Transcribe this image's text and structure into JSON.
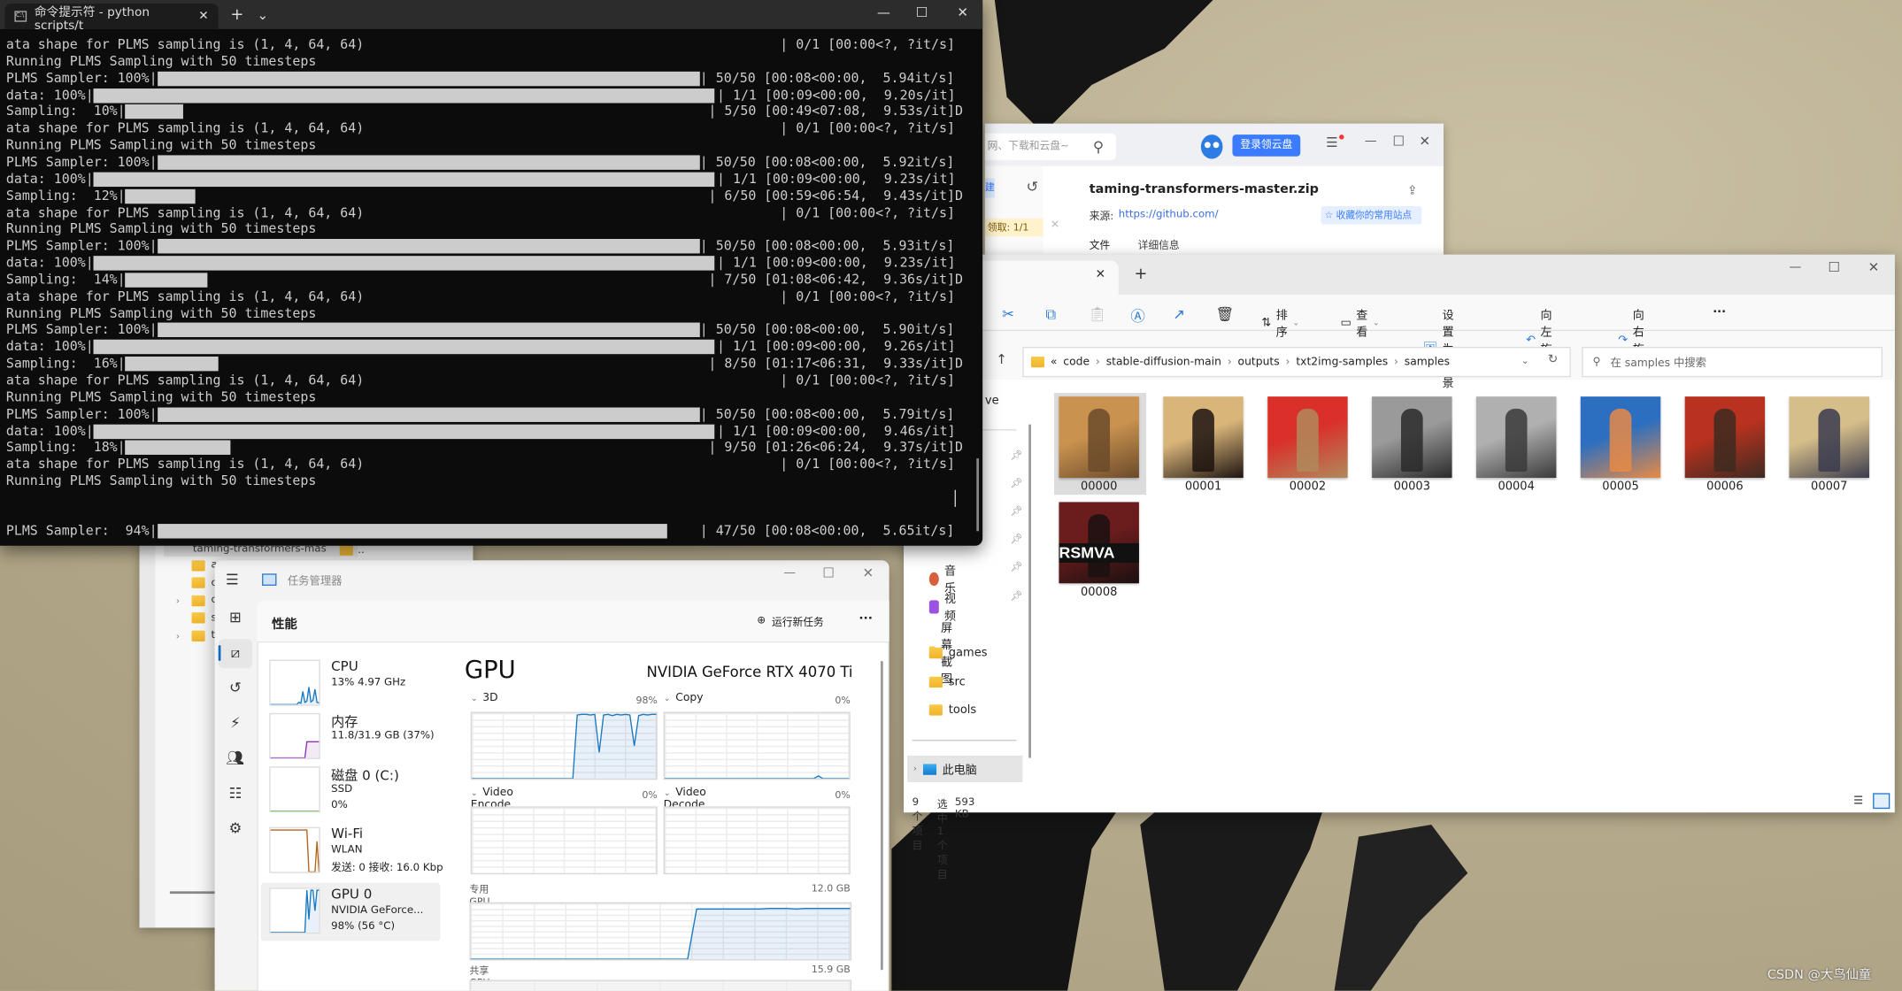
{
  "terminal": {
    "tab_title": "命令提示符 - python  scripts/t",
    "new_tab": "+",
    "dropdown": "⌄",
    "controls": {
      "minimize": "—",
      "maximize": "☐",
      "close": "✕"
    },
    "lines": [
      {
        "kind": "shape",
        "text": "ata shape for PLMS sampling is (1, 4, 64, 64)",
        "right": "| 0/1 [00:00<?, ?it/s]"
      },
      {
        "kind": "running",
        "text": "Running PLMS Sampling with 50 timesteps"
      },
      {
        "kind": "plms",
        "text": "PLMS Sampler: 100%|",
        "progress": 100,
        "right": "| 50/50 [00:08<00:00,  5.94it/s]"
      },
      {
        "kind": "data",
        "text": "data: 100%|",
        "progress": 100,
        "right": "| 1/1 [00:09<00:00,  9.20s/it]"
      },
      {
        "kind": "sampling",
        "text": "Sampling:  10%|",
        "progress": 10,
        "right": "| 5/50 [00:49<07:08,  9.53s/it]D"
      },
      {
        "kind": "shape",
        "text": "ata shape for PLMS sampling is (1, 4, 64, 64)",
        "right": "| 0/1 [00:00<?, ?it/s]"
      },
      {
        "kind": "running",
        "text": "Running PLMS Sampling with 50 timesteps"
      },
      {
        "kind": "plms",
        "text": "PLMS Sampler: 100%|",
        "progress": 100,
        "right": "| 50/50 [00:08<00:00,  5.92it/s]"
      },
      {
        "kind": "data",
        "text": "data: 100%|",
        "progress": 100,
        "right": "| 1/1 [00:09<00:00,  9.23s/it]"
      },
      {
        "kind": "sampling",
        "text": "Sampling:  12%|",
        "progress": 12,
        "right": "| 6/50 [00:59<06:54,  9.43s/it]D"
      },
      {
        "kind": "shape",
        "text": "ata shape for PLMS sampling is (1, 4, 64, 64)",
        "right": "| 0/1 [00:00<?, ?it/s]"
      },
      {
        "kind": "running",
        "text": "Running PLMS Sampling with 50 timesteps"
      },
      {
        "kind": "plms",
        "text": "PLMS Sampler: 100%|",
        "progress": 100,
        "right": "| 50/50 [00:08<00:00,  5.93it/s]"
      },
      {
        "kind": "data",
        "text": "data: 100%|",
        "progress": 100,
        "right": "| 1/1 [00:09<00:00,  9.23s/it]"
      },
      {
        "kind": "sampling",
        "text": "Sampling:  14%|",
        "progress": 14,
        "right": "| 7/50 [01:08<06:42,  9.36s/it]D"
      },
      {
        "kind": "shape",
        "text": "ata shape for PLMS sampling is (1, 4, 64, 64)",
        "right": "| 0/1 [00:00<?, ?it/s]"
      },
      {
        "kind": "running",
        "text": "Running PLMS Sampling with 50 timesteps"
      },
      {
        "kind": "plms",
        "text": "PLMS Sampler: 100%|",
        "progress": 100,
        "right": "| 50/50 [00:08<00:00,  5.90it/s]"
      },
      {
        "kind": "data",
        "text": "data: 100%|",
        "progress": 100,
        "right": "| 1/1 [00:09<00:00,  9.26s/it]"
      },
      {
        "kind": "sampling",
        "text": "Sampling:  16%|",
        "progress": 16,
        "right": "| 8/50 [01:17<06:31,  9.33s/it]D"
      },
      {
        "kind": "shape",
        "text": "ata shape for PLMS sampling is (1, 4, 64, 64)",
        "right": "| 0/1 [00:00<?, ?it/s]"
      },
      {
        "kind": "running",
        "text": "Running PLMS Sampling with 50 timesteps"
      },
      {
        "kind": "plms",
        "text": "PLMS Sampler: 100%|",
        "progress": 100,
        "right": "| 50/50 [00:08<00:00,  5.79it/s]"
      },
      {
        "kind": "data",
        "text": "data: 100%|",
        "progress": 100,
        "right": "| 1/1 [00:09<00:00,  9.46s/it]"
      },
      {
        "kind": "sampling",
        "text": "Sampling:  18%|",
        "progress": 18,
        "right": "| 9/50 [01:26<06:24,  9.37s/it]D"
      },
      {
        "kind": "shape",
        "text": "ata shape for PLMS sampling is (1, 4, 64, 64)",
        "right": "| 0/1 [00:00<?, ?it/s]"
      },
      {
        "kind": "running",
        "text": "Running PLMS Sampling with 50 timesteps"
      }
    ],
    "last_line": {
      "kind": "plms",
      "text": "PLMS Sampler:  94%|",
      "progress": 94,
      "right": "| 47/50 [00:08<00:00,  5.65it/s]"
    }
  },
  "behind_explorer": {
    "tree_root": "taming-transformers-mas",
    "tree_letters": [
      "a",
      "c",
      "c",
      "s",
      "t"
    ],
    "parent": ".."
  },
  "baidu": {
    "search_placeholder": "网、下载和云盘~",
    "login_button": "登录领云盘",
    "new_button": "建",
    "claim": "领取: 1/1",
    "file_name": "taming-transformers-master.zip",
    "source_label": "来源:",
    "source_url": "https://github.com/",
    "favorite_tag": "收藏你的常用站点",
    "tabs": [
      "文件",
      "详细信息"
    ],
    "accent": "#3b7cff"
  },
  "explorer": {
    "tab_close": "✕",
    "new_tab": "+",
    "toolbar": {
      "sort": "排序",
      "view": "查看",
      "set_background": "设置为背景",
      "rotate_left": "向左旋转",
      "rotate_right": "向右旋转",
      "more": "···"
    },
    "breadcrumb": [
      "code",
      "stable-diffusion-main",
      "outputs",
      "txt2img-samples",
      "samples"
    ],
    "search_placeholder": "在 samples 中搜索",
    "nav_partial": "ve",
    "nav_items": [
      {
        "label": "音乐",
        "icon": "music-icon"
      },
      {
        "label": "视频",
        "icon": "video-icon"
      },
      {
        "label": "屏幕截图",
        "icon": "folder-icon"
      },
      {
        "label": "games",
        "icon": "folder-icon"
      },
      {
        "label": "src",
        "icon": "folder-icon"
      },
      {
        "label": "tools",
        "icon": "folder-icon"
      }
    ],
    "this_pc": "此电脑",
    "files": [
      {
        "name": "00000",
        "colors": [
          "#c9924f",
          "#6b4a2a"
        ],
        "selected": true
      },
      {
        "name": "00001",
        "colors": [
          "#d9b57a",
          "#1d1410"
        ]
      },
      {
        "name": "00002",
        "colors": [
          "#d9302a",
          "#b08a5c"
        ]
      },
      {
        "name": "00003",
        "colors": [
          "#9a9a9a",
          "#2a2a2a"
        ]
      },
      {
        "name": "00004",
        "colors": [
          "#b0b0b0",
          "#3a3a3a"
        ]
      },
      {
        "name": "00005",
        "colors": [
          "#2c6fc0",
          "#e88a45"
        ]
      },
      {
        "name": "00006",
        "colors": [
          "#b8321f",
          "#3d2a20"
        ]
      },
      {
        "name": "00007",
        "colors": [
          "#d6be8a",
          "#3a3b4d"
        ]
      },
      {
        "name": "00008",
        "colors": [
          "#6b1c1c",
          "#1a1010"
        ],
        "overlay": "RSMVA"
      }
    ],
    "status": {
      "count": "9 个项目",
      "selected": "选中 1 个项目",
      "size": "593 KB"
    }
  },
  "task_manager": {
    "title": "任务管理器",
    "section": "性能",
    "run_task": "运行新任务",
    "more": "···",
    "perf_items": [
      {
        "title": "CPU",
        "lines": [
          "13% 4.97 GHz"
        ],
        "color": "#1a7ac4"
      },
      {
        "title": "内存",
        "lines": [
          "11.8/31.9 GB (37%)"
        ],
        "color": "#8e2fb5"
      },
      {
        "title": "磁盘 0 (C:)",
        "lines": [
          "SSD",
          "0%"
        ],
        "color": "#4c9b1f"
      },
      {
        "title": "Wi-Fi",
        "lines": [
          "WLAN",
          "发送: 0 接收: 16.0 Kbp"
        ],
        "color": "#b5651d"
      },
      {
        "title": "GPU 0",
        "lines": [
          "NVIDIA GeForce...",
          "98% (56 °C)"
        ],
        "color": "#1a7ac4",
        "selected": true
      }
    ],
    "gpu": {
      "heading": "GPU",
      "model": "NVIDIA GeForce RTX 4070 Ti",
      "engines": [
        {
          "name": "3D",
          "value": "98%",
          "series": [
            0,
            0,
            0,
            0,
            0,
            0,
            0,
            0,
            0,
            0,
            0,
            0,
            0,
            0,
            0,
            0,
            0,
            0,
            0,
            0,
            0,
            0,
            0,
            0,
            97,
            98,
            98,
            97,
            98,
            40,
            97,
            98,
            96,
            98,
            97,
            98,
            97,
            50,
            96,
            98,
            97,
            98,
            98
          ]
        },
        {
          "name": "Copy",
          "value": "0%",
          "series": [
            0,
            0,
            0,
            0,
            0,
            0,
            0,
            0,
            0,
            0,
            0,
            0,
            0,
            0,
            0,
            0,
            0,
            0,
            0,
            0,
            0,
            0,
            0,
            0,
            0,
            0,
            0,
            0,
            0,
            0,
            0,
            0,
            0,
            0,
            0,
            4,
            0,
            0,
            0,
            0,
            0,
            0,
            0
          ]
        },
        {
          "name": "Video Encode",
          "value": "0%",
          "series": []
        },
        {
          "name": "Video Decode",
          "value": "0%",
          "series": []
        }
      ],
      "dedicated_label": "专用 GPU 内存利用率",
      "dedicated_max": "12.0 GB",
      "dedicated_series": [
        0,
        0,
        0,
        0,
        0,
        0,
        0,
        0,
        0,
        0,
        0,
        0,
        0,
        0,
        0,
        0,
        0,
        0,
        0,
        0,
        0,
        0,
        0,
        0,
        0,
        90,
        90,
        90,
        90,
        90,
        90,
        90,
        90,
        91,
        91,
        91,
        90,
        91,
        91,
        91,
        91,
        91,
        91
      ],
      "shared_label": "共享 GPU 内存利用率",
      "shared_max": "15.9 GB",
      "accent": "#1a7ac4"
    }
  },
  "watermark": "CSDN @大鸟仙童"
}
